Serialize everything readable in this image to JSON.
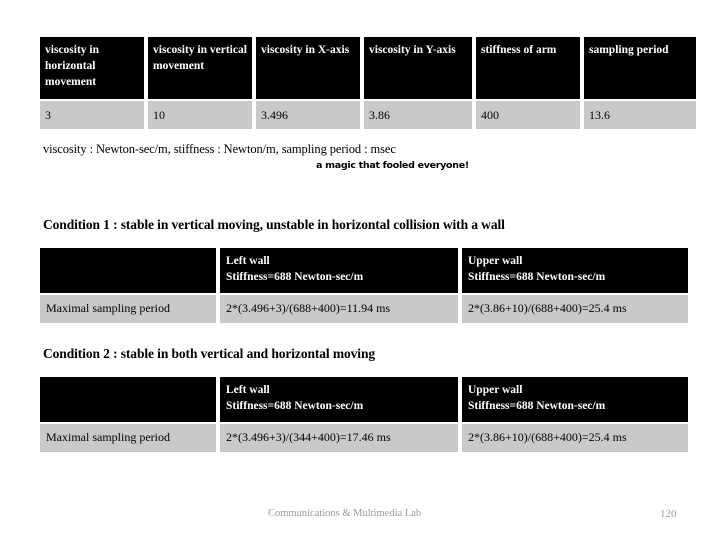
{
  "param_table": {
    "headers": [
      "viscosity in horizontal movement",
      "viscosity in vertical movement",
      "viscosity in X-axis",
      "viscosity in Y-axis",
      "stiffness of arm",
      "sampling period"
    ],
    "values": [
      "3",
      "10",
      "3.496",
      "3.86",
      "400",
      "13.6"
    ]
  },
  "notes": {
    "units": "viscosity : Newton-sec/m, stiffness : Newton/m, sampling period : msec",
    "magic": "a magic that fooled everyone!"
  },
  "condition1": {
    "heading": "Condition 1 : stable in vertical moving, unstable in horizontal collision with a wall",
    "headers": {
      "corner": "",
      "left_wall_line1": "Left wall",
      "left_wall_line2": "Stiffness=688 Newton-sec/m",
      "upper_wall_line1": "Upper wall",
      "upper_wall_line2": "Stiffness=688 Newton-sec/m"
    },
    "row": {
      "label": "Maximal sampling period",
      "left_wall": "2*(3.496+3)/(688+400)=11.94 ms",
      "upper_wall": "2*(3.86+10)/(688+400)=25.4 ms"
    }
  },
  "condition2": {
    "heading": "Condition 2 : stable in both vertical and horizontal moving",
    "headers": {
      "corner": "",
      "left_wall_line1": "Left wall",
      "left_wall_line2": "Stiffness=688 Newton-sec/m",
      "upper_wall_line1": "Upper wall",
      "upper_wall_line2": "Stiffness=688 Newton-sec/m"
    },
    "row": {
      "label": "Maximal sampling period",
      "left_wall": "2*(3.496+3)/(344+400)=17.46 ms",
      "upper_wall": "2*(3.86+10)/(688+400)=25.4 ms"
    }
  },
  "footer": {
    "lab": "Communications & Multimedia Lab",
    "page": "120"
  },
  "colors": {
    "header_bg": "#000000",
    "header_fg": "#ffffff",
    "cell_bg": "#c9c9c9",
    "text": "#000000",
    "footer_text": "#9a9a9a",
    "slide_bg": "#ffffff"
  }
}
